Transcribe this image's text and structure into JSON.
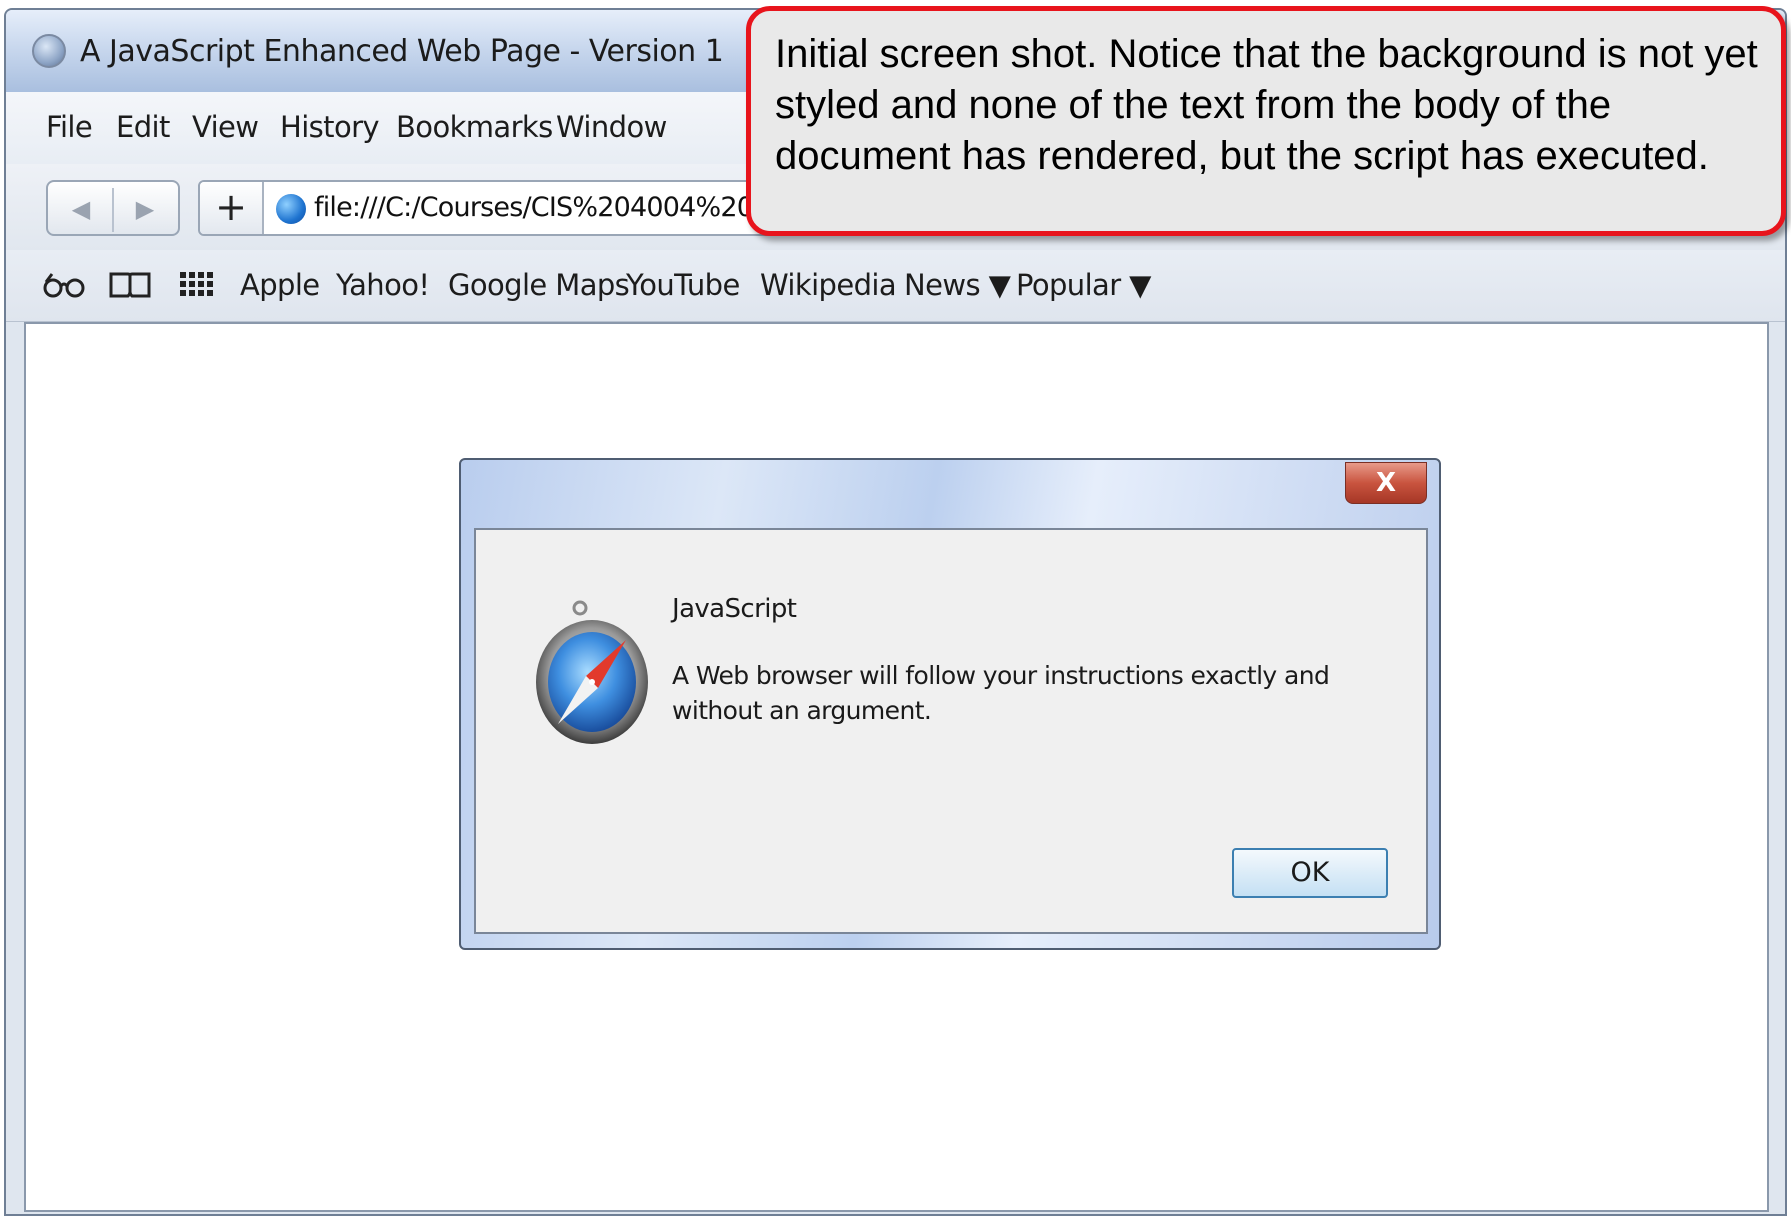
{
  "window": {
    "title": "A JavaScript Enhanced Web Page - Version 1"
  },
  "menu": [
    "File",
    "Edit",
    "View",
    "History",
    "Bookmarks",
    "Window"
  ],
  "toolbar": {
    "add_label": "+",
    "url": "file:///C:/Courses/CIS%204004%20"
  },
  "bookmarks": {
    "items": [
      "Apple",
      "Yahoo!",
      "Google Maps",
      "YouTube",
      "Wikipedia"
    ],
    "folders": [
      "News ▼",
      "Popular ▼"
    ],
    "icons": [
      "reading-list-icon",
      "book-icon",
      "grid-icon"
    ]
  },
  "dialog": {
    "close_label": "X",
    "heading": "JavaScript",
    "message": "A Web browser will follow your instructions exactly and without an argument.",
    "ok_label": "OK",
    "icon": "safari-compass-icon"
  },
  "callout": {
    "text": "Initial screen shot.  Notice that the background is not yet styled and none of the text from the body of the document has rendered, but the script has executed."
  },
  "colors": {
    "callout_border": "#e8141c",
    "callout_fill": "#e9e9e9",
    "close_button": "#c9543f"
  }
}
